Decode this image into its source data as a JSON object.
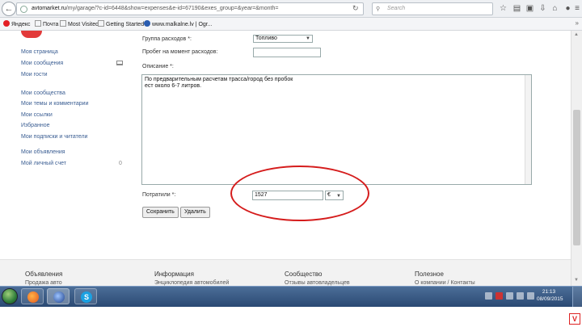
{
  "browser": {
    "url_domain": "avtomarket.ru",
    "url_path": "/my/garage/?c-id=6448&show=expenses&e-id=67190&exes_group=&year=&month=",
    "search_placeholder": "Search",
    "bookmarks": [
      {
        "label": "Яндекс",
        "icon": "yandex-icon",
        "color": "#e31e24"
      },
      {
        "label": "Почта",
        "icon": "mail-folder-icon",
        "color": "#888888"
      },
      {
        "label": "Most Visited",
        "icon": "bookmark-folder-icon",
        "color": "#888888"
      },
      {
        "label": "Getting Started",
        "icon": "page-icon",
        "color": "#888888"
      },
      {
        "label": "www.malkalne.lv | Ogr...",
        "icon": "site-icon",
        "color": "#2a5db0"
      }
    ]
  },
  "sidebar": {
    "group1": [
      "Моя страница",
      "Мои сообщения",
      "Мои гости"
    ],
    "group2": [
      "Мои сообщества",
      "Мои темы и комментарии",
      "Мои ссылки",
      "Избранное",
      "Мои подписки и читатели"
    ],
    "group3": [
      "Мои объявления",
      "Мой личный счет"
    ],
    "account_count": "0"
  },
  "form": {
    "group_label": "Группа расходов *:",
    "group_value": "Топливо",
    "mileage_label": "Пробег на момент расходов:",
    "mileage_value": "",
    "description_label": "Описание *:",
    "description_line1": "По предварительным расчетам трасса/город без пробок",
    "description_line2": "ест около 6-7 литров.",
    "spent_label": "Потратили *:",
    "spent_value": "1527",
    "currency": "€",
    "save_label": "Сохранить",
    "delete_label": "Удалить"
  },
  "footer": {
    "columns": [
      {
        "title": "Объявления",
        "sub": "Продажа авто"
      },
      {
        "title": "Информация",
        "sub": "Энциклопедия автомобилей"
      },
      {
        "title": "Сообщество",
        "sub": "Отзывы автовладельцев"
      },
      {
        "title": "Полезное",
        "sub": "О компании / Контакты"
      }
    ]
  },
  "taskbar": {
    "time": "21:13",
    "date": "08/09/2015"
  },
  "colors": {
    "highlight_oval": "#d51c1c",
    "link": "#3a5d92",
    "brand_red": "#e23a3a"
  }
}
